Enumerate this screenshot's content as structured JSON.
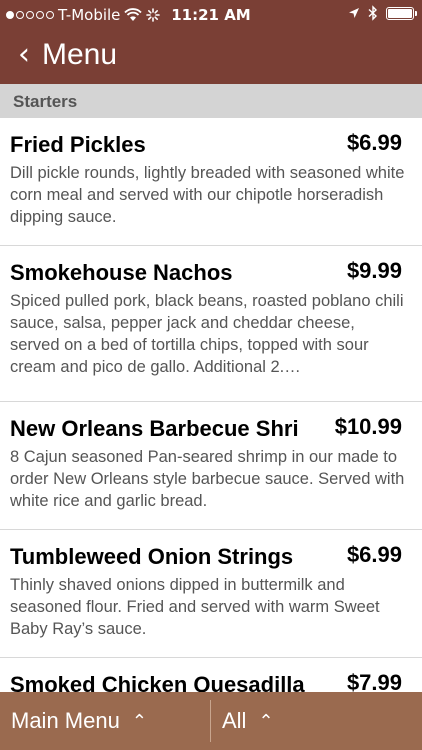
{
  "status_bar": {
    "carrier": "T-Mobile",
    "time": "11:21 AM"
  },
  "nav": {
    "back_glyph": "‹",
    "title": "Menu"
  },
  "section": {
    "title": "Starters"
  },
  "items": [
    {
      "title": "Fried Pickles",
      "price": "$6.99",
      "description": "Dill pickle rounds, lightly breaded with seasoned white corn meal and served with our chipotle horseradish dipping sauce."
    },
    {
      "title": "Smokehouse Nachos",
      "price": "$9.99",
      "description": "Spiced pulled pork, black beans, roasted poblano chili sauce, salsa, pepper jack and cheddar cheese, served on a bed of tortilla chips, topped with sour cream and pico de gallo. Additional 2.…"
    },
    {
      "title": "New Orleans Barbecue Shri",
      "price": "$10.99",
      "description": "8 Cajun seasoned Pan-seared shrimp in our made to order New Orleans style barbecue sauce. Served with white rice and garlic bread."
    },
    {
      "title": "Tumbleweed Onion Strings",
      "price": "$6.99",
      "description": "Thinly shaved onions dipped in buttermilk and seasoned flour. Fried and served with warm Sweet Baby Ray’s sauce."
    },
    {
      "title": "Smoked Chicken Quesadilla",
      "price": "$7.99",
      "description": ""
    }
  ],
  "bottom_bar": {
    "main_menu_label": "Main Menu",
    "all_label": "All",
    "chevron_glyph": "⌃"
  },
  "colors": {
    "header_brown": "#7a3f35",
    "bottom_bar_brown": "#9a6a4f",
    "section_gray": "#d4d4d4"
  }
}
